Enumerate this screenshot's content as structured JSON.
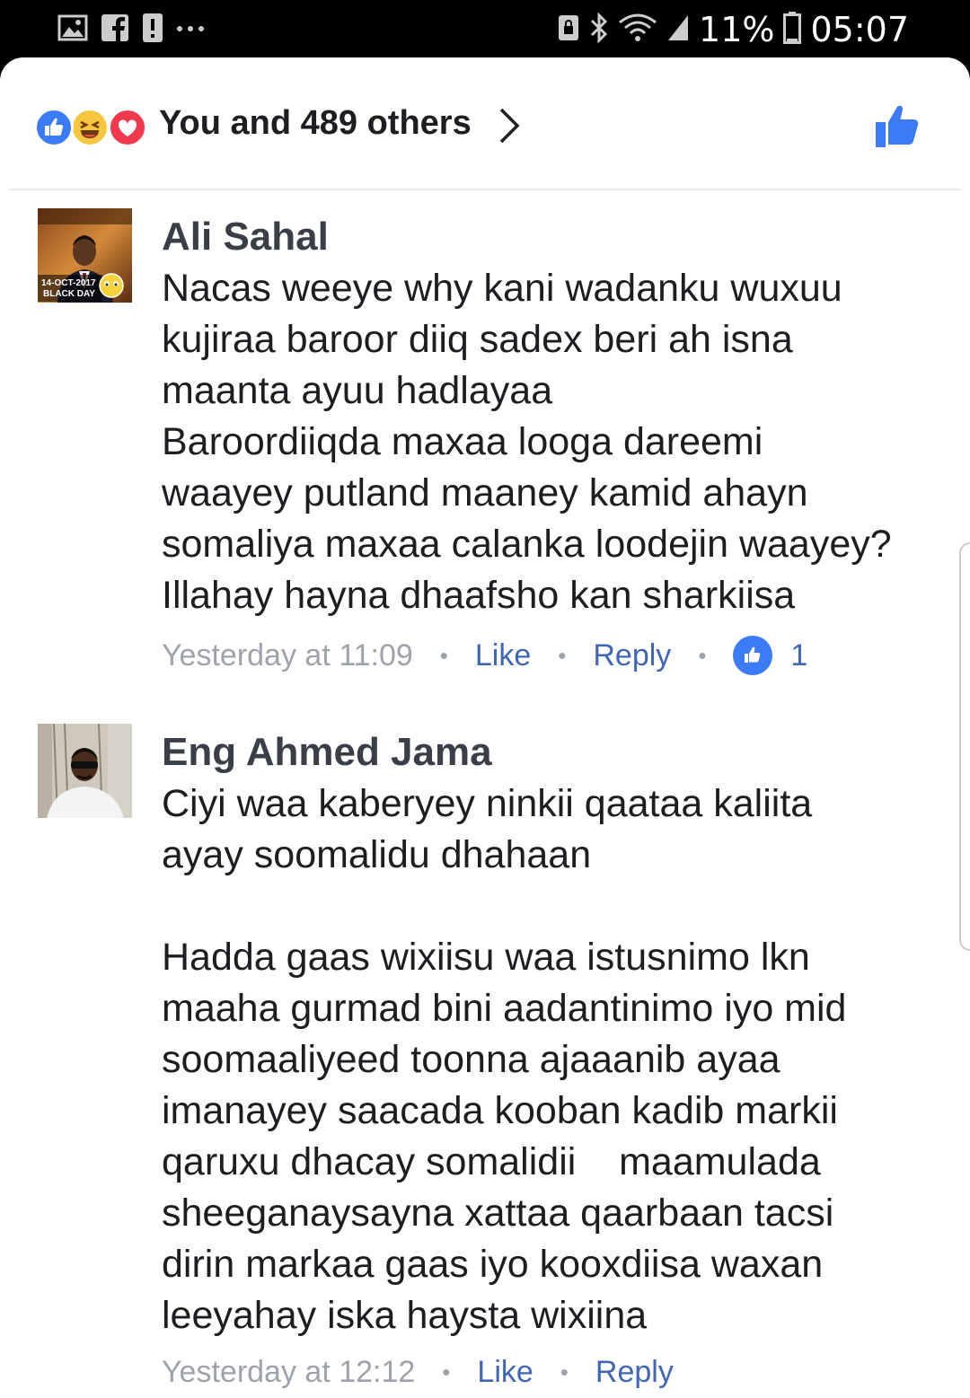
{
  "status_bar": {
    "battery": "11%",
    "time": "05:07",
    "left_icons": [
      "gallery-icon",
      "facebook-icon",
      "alert-icon",
      "more-icon"
    ],
    "right_icons": [
      "lock-icon",
      "bluetooth-icon",
      "wifi-icon",
      "signal-icon",
      "battery-icon"
    ]
  },
  "reactions": {
    "summary": "You and 489 others",
    "types": [
      "like",
      "haha",
      "love"
    ]
  },
  "comments": [
    {
      "author": "Ali Sahal",
      "avatar_caption_1": "14-OCT-2017",
      "avatar_caption_2": "BLACK DAY",
      "lines": [
        "Nacas weeye why kani wadanku wuxuu",
        "kujiraa baroor diiq sadex beri ah isna",
        "maanta ayuu hadlayaa",
        "Baroordiiqda maxaa looga dareemi",
        "waayey putland maaney kamid ahayn",
        "somaliya maxaa calanka loodejin waayey?",
        "Illahay hayna dhaafsho kan sharkiisa"
      ],
      "time": "Yesterday at 11:09",
      "like_label": "Like",
      "reply_label": "Reply",
      "like_count": "1"
    },
    {
      "author": "Eng Ahmed Jama",
      "lines": [
        "Ciyi waa kaberyey ninkii qaataa kaliita",
        "ayay soomalidu dhahaan",
        "",
        "Hadda gaas wixiisu waa istusnimo lkn",
        "maaha gurmad bini aadantinimo iyo mid",
        "soomaaliyeed toonna ajaaanib ayaa",
        "imanayey saacada kooban kadib markii",
        "qaruxu dhacay somalidii    maamulada",
        "sheeganaysayna xattaa qaarbaan tacsi",
        "dirin markaa gaas iyo kooxdiisa waxan",
        "leeyahay iska haysta wixiina"
      ],
      "time": "Yesterday at 12:12",
      "like_label": "Like",
      "reply_label": "Reply"
    }
  ],
  "colors": {
    "link_blue": "#4267b2",
    "like_blue": "#3b7cf6",
    "meta_grey": "#9ea3aa"
  }
}
